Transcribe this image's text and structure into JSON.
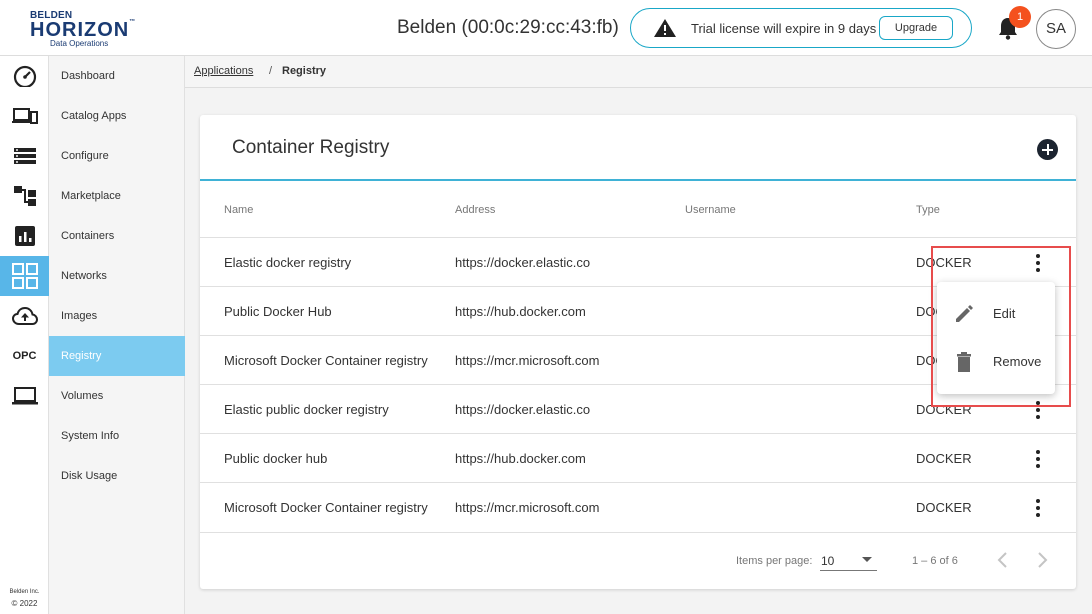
{
  "brand": {
    "top": "BELDEN",
    "name": "HORIZON",
    "tm": "™",
    "sub": "Data Operations"
  },
  "header": {
    "device_title": "Belden (00:0c:29:cc:43:fb)",
    "trial_text": "Trial license will expire in 9 days",
    "upgrade_label": "Upgrade",
    "notification_count": "1",
    "avatar_initials": "SA"
  },
  "rail": {
    "icons": [
      "dashboard-gauge-icon",
      "devices-icon",
      "list-icon",
      "hierarchy-icon",
      "bar-chart-icon",
      "grid-apps-icon",
      "cloud-upload-icon",
      "opc-label",
      "laptop-icon"
    ],
    "opc_label": "OPC",
    "footer_company": "Belden Inc.",
    "footer_year": "© 2022"
  },
  "nav": {
    "items": [
      {
        "label": "Dashboard"
      },
      {
        "label": "Catalog Apps"
      },
      {
        "label": "Configure"
      },
      {
        "label": "Marketplace"
      },
      {
        "label": "Containers"
      },
      {
        "label": "Networks"
      },
      {
        "label": "Images"
      },
      {
        "label": "Registry"
      },
      {
        "label": "Volumes"
      },
      {
        "label": "System Info"
      },
      {
        "label": "Disk Usage"
      }
    ],
    "active": "Registry"
  },
  "breadcrumb": {
    "parent": "Applications",
    "separator": "/",
    "current": "Registry"
  },
  "card": {
    "title": "Container Registry",
    "add_icon": "add-circle-icon"
  },
  "table": {
    "columns": [
      "Name",
      "Address",
      "Username",
      "Type"
    ],
    "rows": [
      {
        "name": "Elastic docker registry",
        "address": "https://docker.elastic.co",
        "username": "",
        "type": "DOCKER"
      },
      {
        "name": "Public Docker Hub",
        "address": "https://hub.docker.com",
        "username": "",
        "type": "DOCKER"
      },
      {
        "name": "Microsoft Docker Container registry",
        "address": "https://mcr.microsoft.com",
        "username": "",
        "type": "DOCKER"
      },
      {
        "name": "Elastic public docker registry",
        "address": "https://docker.elastic.co",
        "username": "",
        "type": "DOCKER"
      },
      {
        "name": "Public docker hub",
        "address": "https://hub.docker.com",
        "username": "",
        "type": "DOCKER"
      },
      {
        "name": "Microsoft Docker Container registry",
        "address": "https://mcr.microsoft.com",
        "username": "",
        "type": "DOCKER"
      }
    ]
  },
  "pagination": {
    "items_per_page_label": "Items per page:",
    "items_per_page": "10",
    "range": "1 – 6 of 6"
  },
  "menu": {
    "edit_label": "Edit",
    "remove_label": "Remove"
  },
  "colors": {
    "accent": "#3fb2d6",
    "active_rail": "#58b6e8",
    "active_nav": "#7ccbf0",
    "badge": "#f4511e",
    "highlight": "#e74c4c"
  }
}
